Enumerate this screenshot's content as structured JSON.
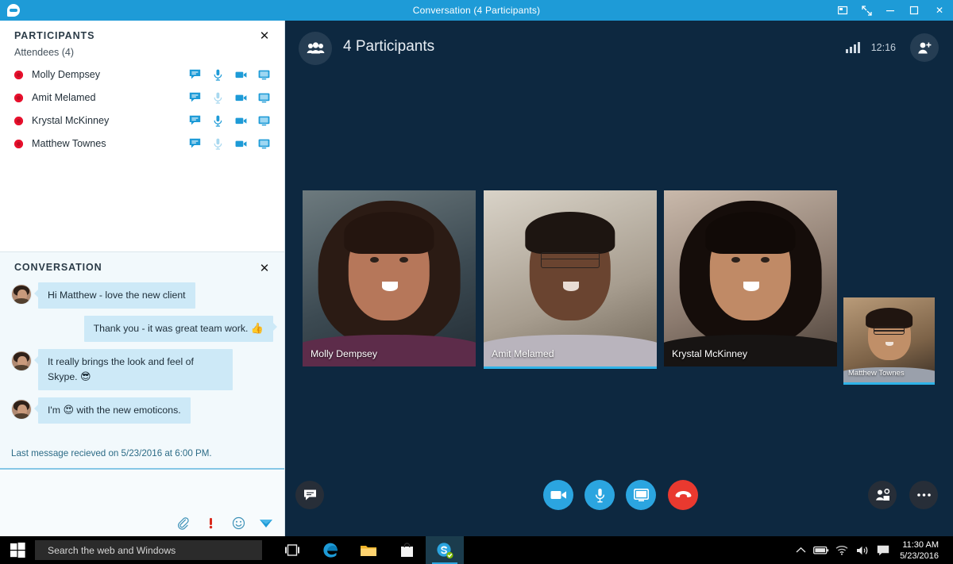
{
  "window": {
    "title": "Conversation (4 Participants)",
    "logo_icon": "skype-logo-icon",
    "buttons": {
      "popout_label": "pop-out-icon",
      "fullscreen_label": "fullscreen-icon",
      "minimize_label": "minimize-icon",
      "maximize_label": "maximize-icon",
      "close_label": "✕"
    }
  },
  "participants_panel": {
    "title": "PARTICIPANTS",
    "subtitle": "Attendees (4)",
    "close_label": "✕",
    "people": [
      {
        "name": "Molly Dempsey",
        "presence": "busy",
        "chat": true,
        "mic_muted": false,
        "video": true,
        "share": true
      },
      {
        "name": "Amit Melamed",
        "presence": "busy",
        "chat": true,
        "mic_muted": true,
        "video": true,
        "share": true
      },
      {
        "name": "Krystal McKinney",
        "presence": "busy",
        "chat": true,
        "mic_muted": false,
        "video": true,
        "share": true
      },
      {
        "name": "Matthew Townes",
        "presence": "busy",
        "chat": true,
        "mic_muted": true,
        "video": true,
        "share": true
      }
    ],
    "invite_button": "Invite More People",
    "actions_button": "Participant Actions"
  },
  "conversation_panel": {
    "title": "CONVERSATION",
    "close_label": "✕",
    "messages": [
      {
        "text": "Hi Matthew - love the new client",
        "side": "in",
        "emoji": "",
        "avatar": true
      },
      {
        "text": "Thank you - it was great team work.",
        "side": "out",
        "emoji": "👍",
        "avatar": false
      },
      {
        "text": "It really brings the look and feel of Skype.",
        "side": "in",
        "emoji": "😎",
        "avatar": true
      },
      {
        "text": "I'm",
        "text2": "with the new emoticons.",
        "side": "in",
        "emoji": "😍",
        "avatar": true
      }
    ],
    "last_message_note": "Last message recieved on 5/23/2016 at 6:00 PM.",
    "compose_tools": [
      {
        "icon": "paperclip-icon",
        "label": "Attach file"
      },
      {
        "icon": "importance-icon",
        "label": "High importance"
      },
      {
        "icon": "emoticon-icon",
        "label": "Emoticons"
      },
      {
        "icon": "send-icon",
        "label": "Send"
      }
    ]
  },
  "stage": {
    "header": {
      "group_icon": "group-people-icon",
      "title": "4 Participants",
      "signal_icon": "signal-strength-icon",
      "timer": "12:16",
      "add_people_icon": "add-person-icon"
    },
    "video_tiles": [
      {
        "name": "Molly Dempsey",
        "active_speaker": false,
        "size": "large"
      },
      {
        "name": "Amit Melamed",
        "active_speaker": true,
        "size": "large"
      },
      {
        "name": "Krystal McKinney",
        "active_speaker": false,
        "size": "large"
      },
      {
        "name": "Matthew Townes",
        "active_speaker": true,
        "size": "small"
      }
    ],
    "controls": [
      {
        "name": "chat-toggle",
        "icon": "chat-bubble-icon",
        "style": "dark"
      },
      {
        "name": "video-toggle",
        "icon": "video-camera-icon",
        "style": "blue"
      },
      {
        "name": "mic-toggle",
        "icon": "microphone-icon",
        "style": "blue"
      },
      {
        "name": "screen-share",
        "icon": "monitor-icon",
        "style": "blue"
      },
      {
        "name": "end-call",
        "icon": "hang-up-icon",
        "style": "red"
      },
      {
        "name": "manage-people",
        "icon": "manage-people-icon",
        "style": "dark"
      },
      {
        "name": "more-options",
        "icon": "ellipsis-icon",
        "style": "dark"
      }
    ]
  },
  "taskbar": {
    "start_icon": "windows-start-icon",
    "search_placeholder": "Search the web and Windows",
    "pinned": [
      {
        "icon": "task-view-icon",
        "name": "task-view"
      },
      {
        "icon": "edge-icon",
        "name": "microsoft-edge"
      },
      {
        "icon": "file-explorer-icon",
        "name": "file-explorer"
      },
      {
        "icon": "store-icon",
        "name": "windows-store"
      },
      {
        "icon": "skype-icon",
        "name": "skype-for-business",
        "active": true
      }
    ],
    "tray": [
      {
        "icon": "chevron-up-icon"
      },
      {
        "icon": "battery-icon"
      },
      {
        "icon": "wifi-icon"
      },
      {
        "icon": "volume-icon"
      },
      {
        "icon": "action-center-icon"
      }
    ],
    "time": "11:30 AM",
    "date": "5/23/2016"
  },
  "colors": {
    "title_bar": "#1e9bd7",
    "stage_bg": "#0d2840",
    "accent_blue": "#2ba5e0",
    "active_speaker": "#2fb3e8",
    "end_call_red": "#e9392f",
    "presence_busy": "#e8112d",
    "bubble": "#cde9f7"
  }
}
